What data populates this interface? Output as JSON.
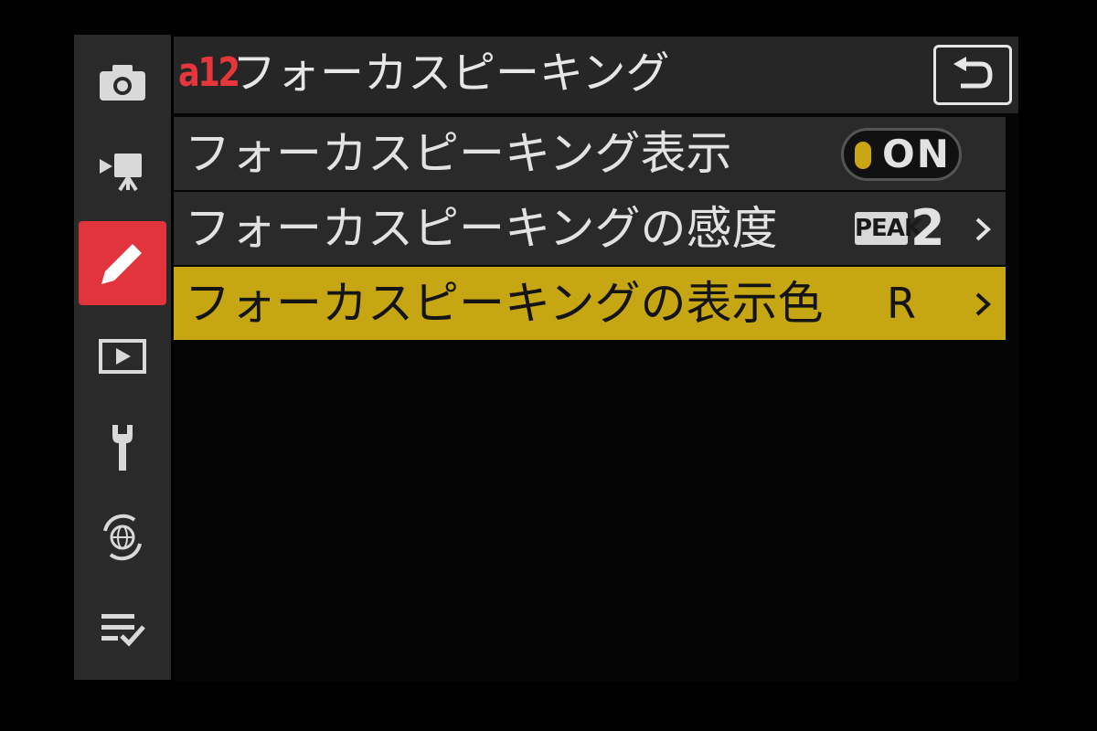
{
  "sidebar": {
    "items": [
      {
        "icon": "camera-icon"
      },
      {
        "icon": "movie-camera-icon"
      },
      {
        "icon": "pencil-icon",
        "active": true
      },
      {
        "icon": "playback-icon"
      },
      {
        "icon": "wrench-icon"
      },
      {
        "icon": "network-icon"
      },
      {
        "icon": "my-menu-icon"
      }
    ]
  },
  "header": {
    "code": "a12",
    "title": "フォーカスピーキング",
    "back_icon": "back-arrow-icon"
  },
  "menu": {
    "items": [
      {
        "label": "フォーカスピーキング表示",
        "value": "ON"
      },
      {
        "label": "フォーカスピーキングの感度",
        "badge": "PEAK",
        "value": "2"
      },
      {
        "label": "フォーカスピーキングの表示色",
        "value": "R",
        "selected": true
      }
    ]
  },
  "colors": {
    "accent_red": "#e1343c",
    "selected_yellow": "#c6a612",
    "row_gray": "#2a2a2a"
  }
}
